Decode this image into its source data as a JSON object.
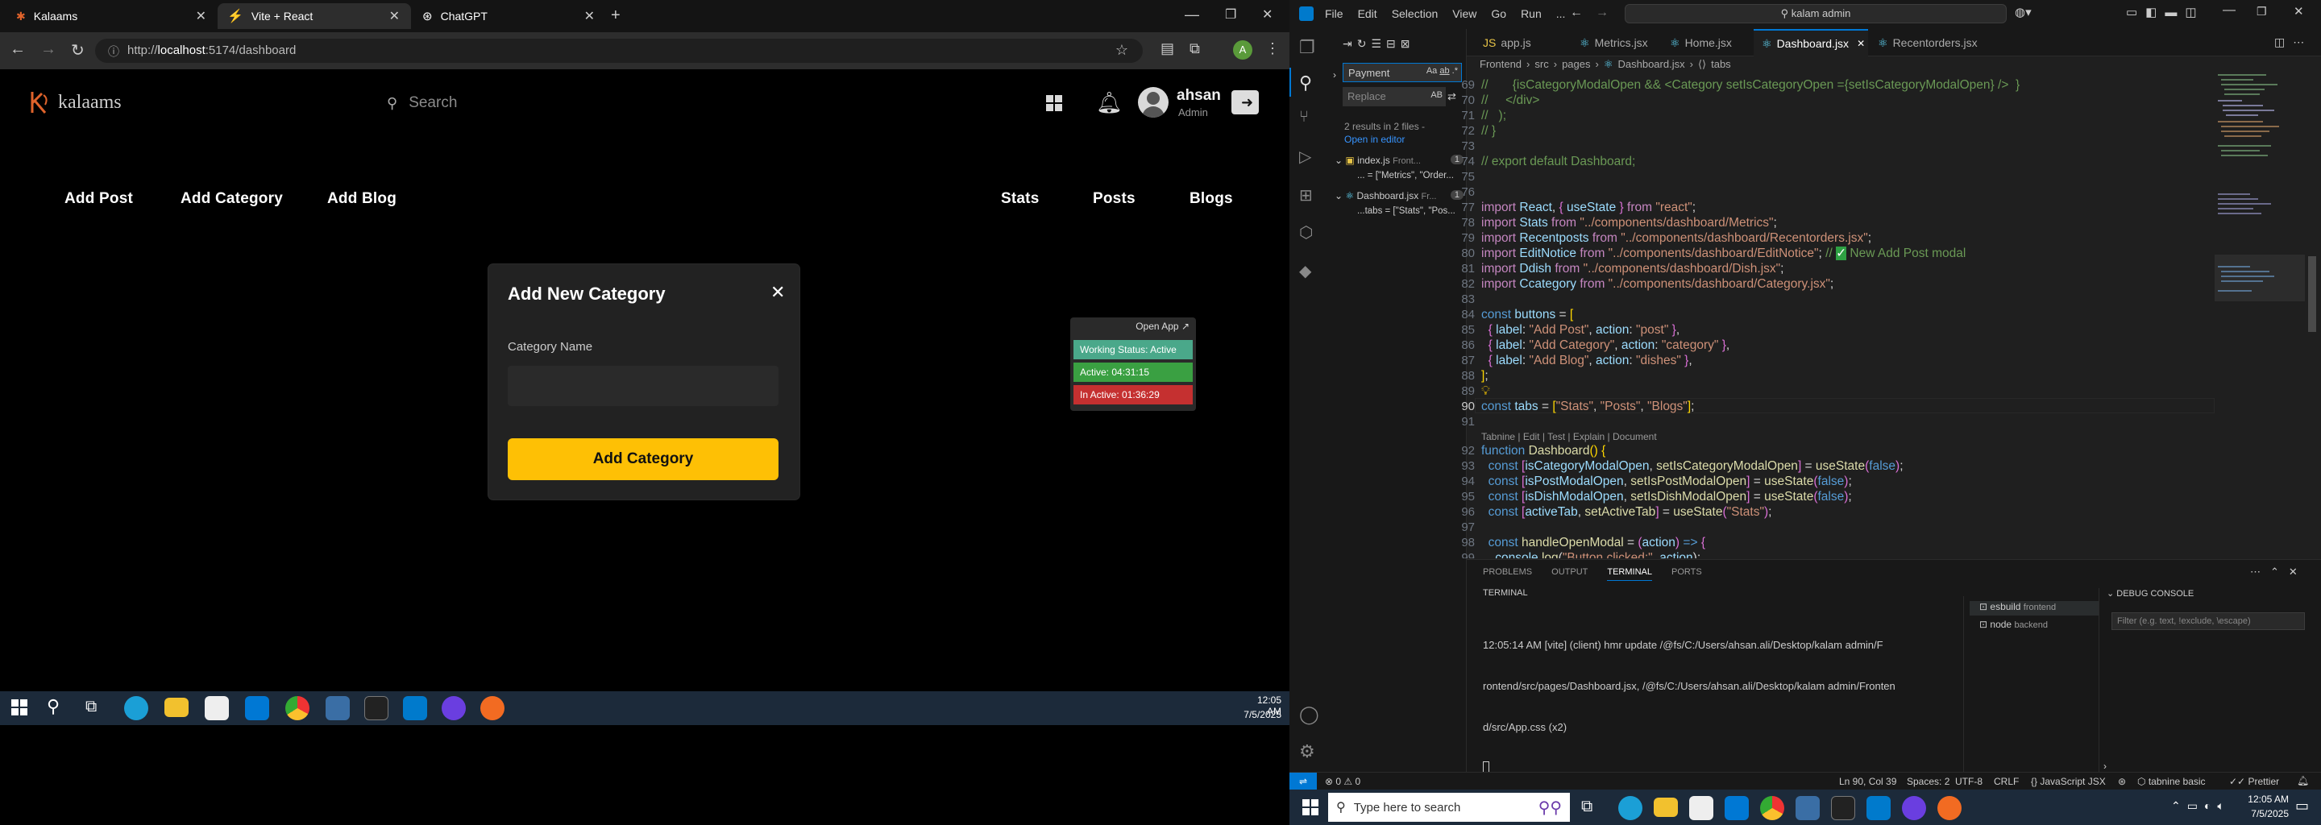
{
  "browser": {
    "tabs": [
      {
        "title": "Kalaams"
      },
      {
        "title": "Vite + React"
      },
      {
        "title": "ChatGPT"
      }
    ],
    "url": "http://localhost:5174/dashboard",
    "url_host": "localhost",
    "url_path": ":5174/dashboard",
    "url_scheme": "http://"
  },
  "app": {
    "logo": "kalaams",
    "search_placeholder": "Search",
    "user_name": "ahsan",
    "user_role": "Admin",
    "left_actions": [
      "Add Post",
      "Add Category",
      "Add Blog"
    ],
    "right_tabs": [
      "Stats",
      "Posts",
      "Blogs"
    ]
  },
  "modal": {
    "title": "Add New Category",
    "field_label": "Category Name",
    "field_value": "",
    "submit": "Add Category"
  },
  "status_widget": {
    "open_app": "Open App",
    "working": "Working Status: Active",
    "active": "Active: 04:31:15",
    "inactive": "In Active: 01:36:29"
  },
  "left_taskbar": {
    "time": "12:05 AM",
    "date": "7/5/2025"
  },
  "vscode": {
    "menu": [
      "File",
      "Edit",
      "Selection",
      "View",
      "Go",
      "Run",
      "..."
    ],
    "command_center": "kalam admin",
    "tabs": [
      {
        "label": "app.js",
        "color": "#e8c547"
      },
      {
        "label": "Metrics.jsx",
        "color": "#61dafb"
      },
      {
        "label": "Home.jsx",
        "color": "#61dafb"
      },
      {
        "label": "Dashboard.jsx",
        "color": "#61dafb",
        "active": true
      },
      {
        "label": "Recentorders.jsx",
        "color": "#61dafb"
      }
    ],
    "breadcrumb": [
      "Frontend",
      "src",
      "pages",
      "Dashboard.jsx",
      "tabs"
    ],
    "search": {
      "query": "Payment",
      "replace_placeholder": "Replace",
      "summary": "2 results in 2 files -",
      "open_in_editor": "Open in editor",
      "results": [
        {
          "file": "index.js",
          "path": "Front...",
          "count": "1",
          "match": "... = [\"Metrics\", \"Order..."
        },
        {
          "file": "Dashboard.jsx",
          "path": "Fr...",
          "count": "1",
          "match": "...tabs = [\"Stats\", \"Pos..."
        }
      ]
    },
    "codelens": "Tabnine | Edit | Test | Explain | Document",
    "panel_tabs": [
      "PROBLEMS",
      "OUTPUT",
      "TERMINAL",
      "PORTS"
    ],
    "terminal_title": "TERMINAL",
    "terminal_lines": [
      "12:05:14 AM [vite] (client) hmr update /@fs/C:/Users/ahsan.ali/Desktop/kalam admin/F",
      "rontend/src/pages/Dashboard.jsx, /@fs/C:/Users/ahsan.ali/Desktop/kalam admin/Fronten",
      "d/src/App.css (x2)"
    ],
    "terminals": [
      {
        "name": "esbuild",
        "folder": "frontend"
      },
      {
        "name": "node",
        "folder": "backend"
      }
    ],
    "debug_console": "DEBUG CONSOLE",
    "debug_filter": "Filter (e.g. text, !exclude, \\escape)",
    "status_bar": {
      "errors": "0",
      "warnings": "0",
      "position": "Ln 90, Col 39",
      "spaces": "Spaces: 2",
      "encoding": "UTF-8",
      "eol": "CRLF",
      "language": "JavaScript JSX",
      "tabnine": "tabnine basic",
      "prettier": "Prettier"
    }
  },
  "right_taskbar": {
    "search_placeholder": "Type here to search",
    "time": "12:05 AM",
    "date": "7/5/2025"
  }
}
